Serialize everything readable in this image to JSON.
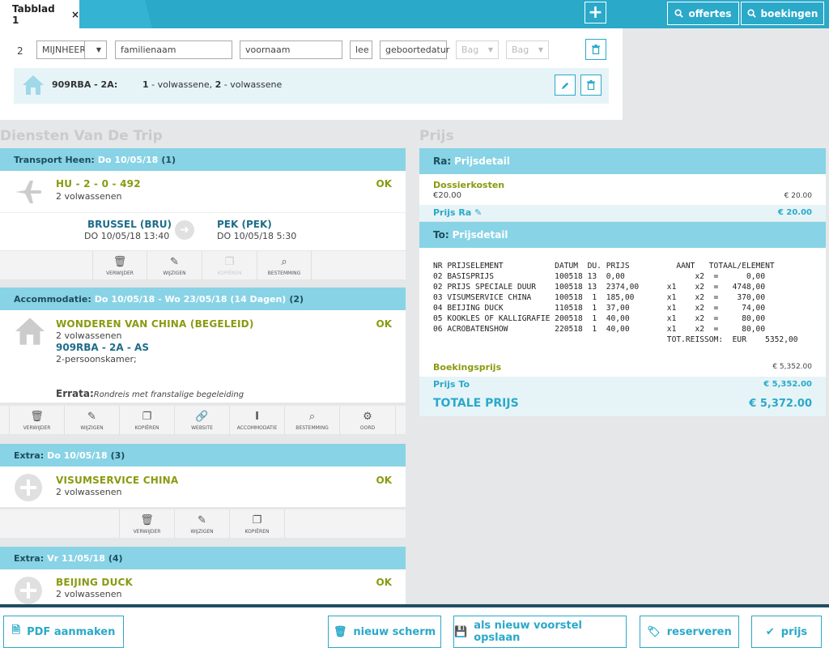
{
  "tabs": {
    "label": "Tabblad 1",
    "close": "×"
  },
  "top_buttons": {
    "offertes": "offertes",
    "boekingen": "boekingen"
  },
  "form": {
    "row_number": "2",
    "title": "MIJNHEER",
    "familienaam": "familienaam",
    "voornaam": "voornaam",
    "lee": "lee",
    "geboortedatum": "geboortedatur",
    "bag1": "Bag",
    "bag2": "Bag"
  },
  "room": {
    "code": "909RBA - 2A:",
    "adults_n1": "1",
    "adults_t1": " - volwassene, ",
    "adults_n2": "2",
    "adults_t2": " - volwassene"
  },
  "sections": {
    "left_title": "Diensten Van De Trip",
    "right_title": "Prijs"
  },
  "services": {
    "transport": {
      "header": "Transport Heen:",
      "date": "Do 10/05/18",
      "count": "(1)",
      "name": "HU - 2 - 0 - 492",
      "sub": "2 volwassenen",
      "status": "OK",
      "from_code": "BRUSSEL (BRU)",
      "from_time": "DO 10/05/18 13:40",
      "to_code": "PEK (PEK)",
      "to_time": "DO 10/05/18 5:30",
      "actions": [
        "verwijder",
        "wijzigen",
        "kopiëren",
        "bestemming"
      ]
    },
    "accommodation": {
      "header": "Accommodatie:",
      "date": "Do 10/05/18 - Wo 23/05/18 (14 Dagen)",
      "count": "(2)",
      "name": "WONDEREN VAN CHINA (BEGELEID)",
      "sub": "2 volwassenen",
      "status": "OK",
      "room": "909RBA - 2A - AS",
      "room_type": "2-persoonskamer;",
      "errata_label": "Errata:",
      "errata_text": "Rondreis met franstalige begeleiding",
      "actions": [
        "verwijder",
        "wijzigen",
        "kopiëren",
        "website",
        "accommodatie",
        "bestemming",
        "oord"
      ]
    },
    "extra1": {
      "header": "Extra:",
      "date": "Do 10/05/18",
      "count": "(3)",
      "name": "VISUMSERVICE CHINA",
      "sub": "2 volwassenen",
      "status": "OK",
      "actions": [
        "verwijder",
        "wijzigen",
        "kopiëren"
      ]
    },
    "extra2": {
      "header": "Extra:",
      "date": "Vr 11/05/18",
      "count": "(4)",
      "name": "BEIJING DUCK",
      "sub": "2 volwassenen",
      "status": "OK"
    }
  },
  "price": {
    "ra": {
      "label": "Ra:",
      "detail": "Prijsdetail",
      "dossier_label": "Dossierkosten",
      "dossier_sub": "€20.00",
      "dossier_val": "€ 20.00",
      "prijs_label": "Prijs Ra",
      "prijs_val": "€ 20.00"
    },
    "to": {
      "label": "To:",
      "detail": "Prijsdetail",
      "table": "NR PRIJSELEMENT           DATUM  DU. PRIJS          AANT   TOTAAL/ELEMENT\n02 BASISPRIJS             100518 13  0,00               x2  =      0,00\n02 PRIJS SPECIALE DUUR    100518 13  2374,00      x1    x2  =   4748,00\n03 VISUMSERVICE CHINA     100518  1  185,00       x1    x2  =    370,00\n04 BEIJING DUCK           110518  1  37,00        x1    x2  =     74,00\n05 KOOKLES OF KALLIGRAFIE 200518  1  40,00        x1    x2  =     80,00\n06 ACROBATENSHOW          220518  1  40,00        x1    x2  =     80,00\n                                                  TOT.REISSOM:  EUR    5352,00",
      "boeking_label": "Boekingsprijs",
      "boeking_val": "€ 5,352.00",
      "prijs_label": "Prijs To",
      "prijs_val": "€ 5,352.00"
    },
    "total_label": "TOTALE PRIJS",
    "total_val": "€ 5,372.00"
  },
  "bottom": {
    "pdf": "PDF aanmaken",
    "nieuw": "nieuw scherm",
    "opslaan": "als nieuw voorstel opslaan",
    "reserveren": "reserveren",
    "prijs": "prijs"
  },
  "colors": {
    "accent": "#2aa9c9",
    "header_bg": "#88d3e6",
    "olive": "#8a9a10",
    "dark_blue": "#1f6d8a"
  }
}
